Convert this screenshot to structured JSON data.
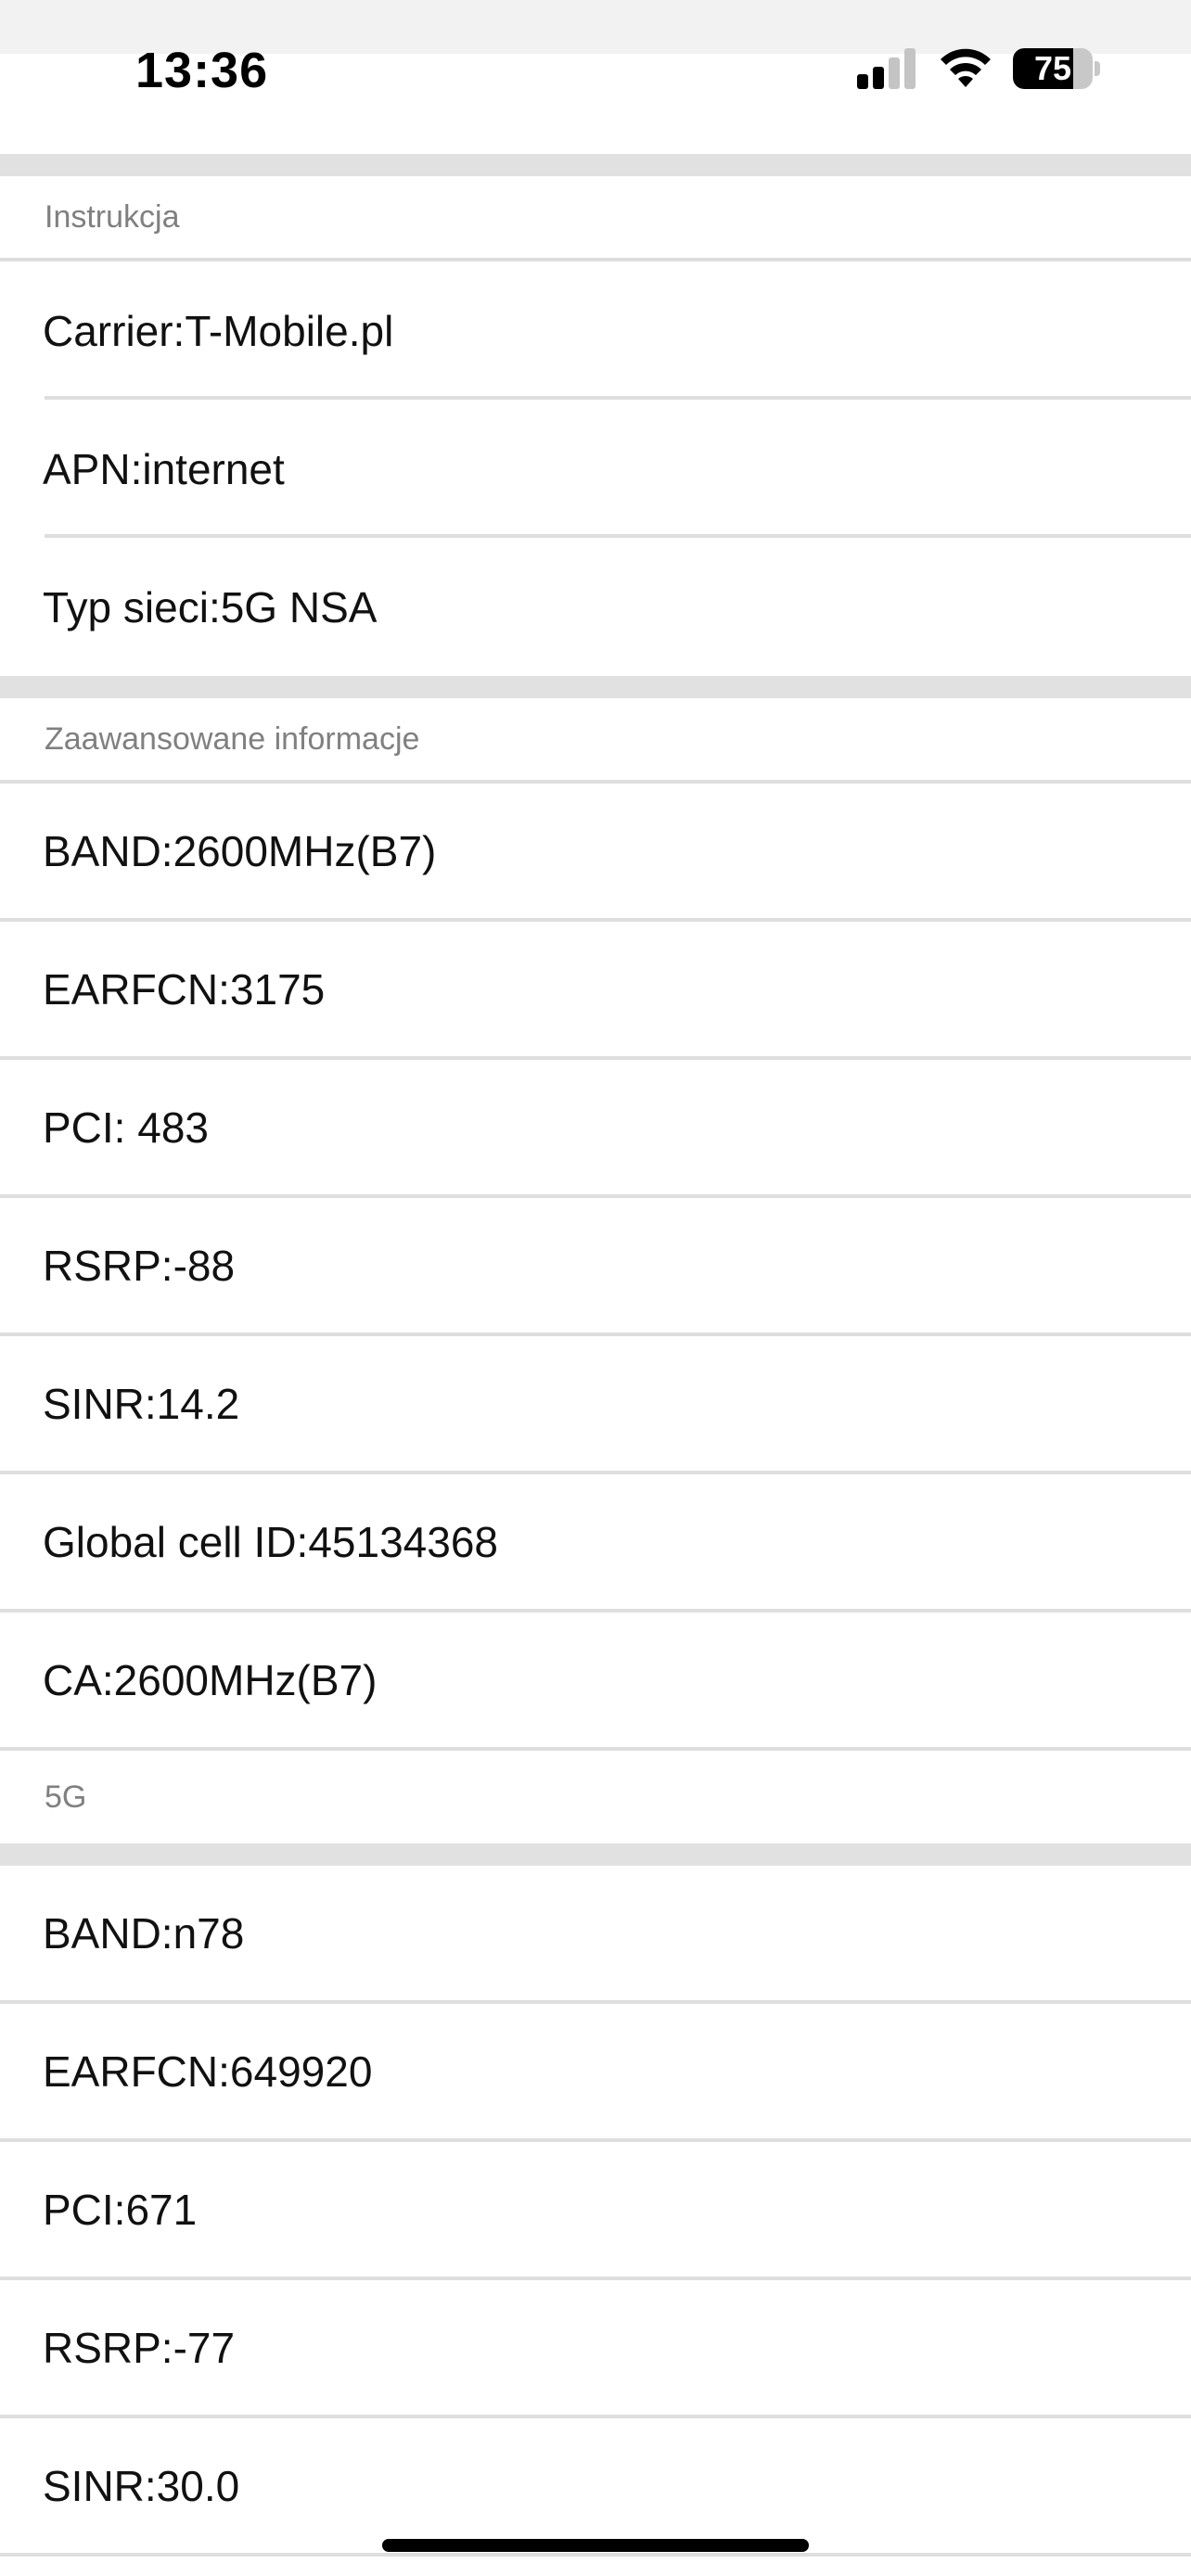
{
  "status_bar": {
    "time": "13:36",
    "battery_level": "75",
    "battery_fraction": 0.75,
    "signal_bars_active": 2,
    "signal_bars_total": 4
  },
  "sections": {
    "instructions": {
      "header": "Instrukcja",
      "rows": [
        "Carrier:T-Mobile.pl",
        "APN:internet",
        "Typ sieci:5G NSA"
      ]
    },
    "advanced": {
      "header": "Zaawansowane informacje",
      "rows": [
        "BAND:2600MHz(B7)",
        "EARFCN:3175",
        "PCI: 483",
        "RSRP:-88",
        "SINR:14.2",
        "Global cell ID:45134368",
        "CA:2600MHz(B7)"
      ]
    },
    "nr5g": {
      "header": "5G",
      "rows": [
        "BAND:n78",
        "EARFCN:649920",
        "PCI:671",
        "RSRP:-77",
        "SINR:30.0"
      ]
    }
  }
}
